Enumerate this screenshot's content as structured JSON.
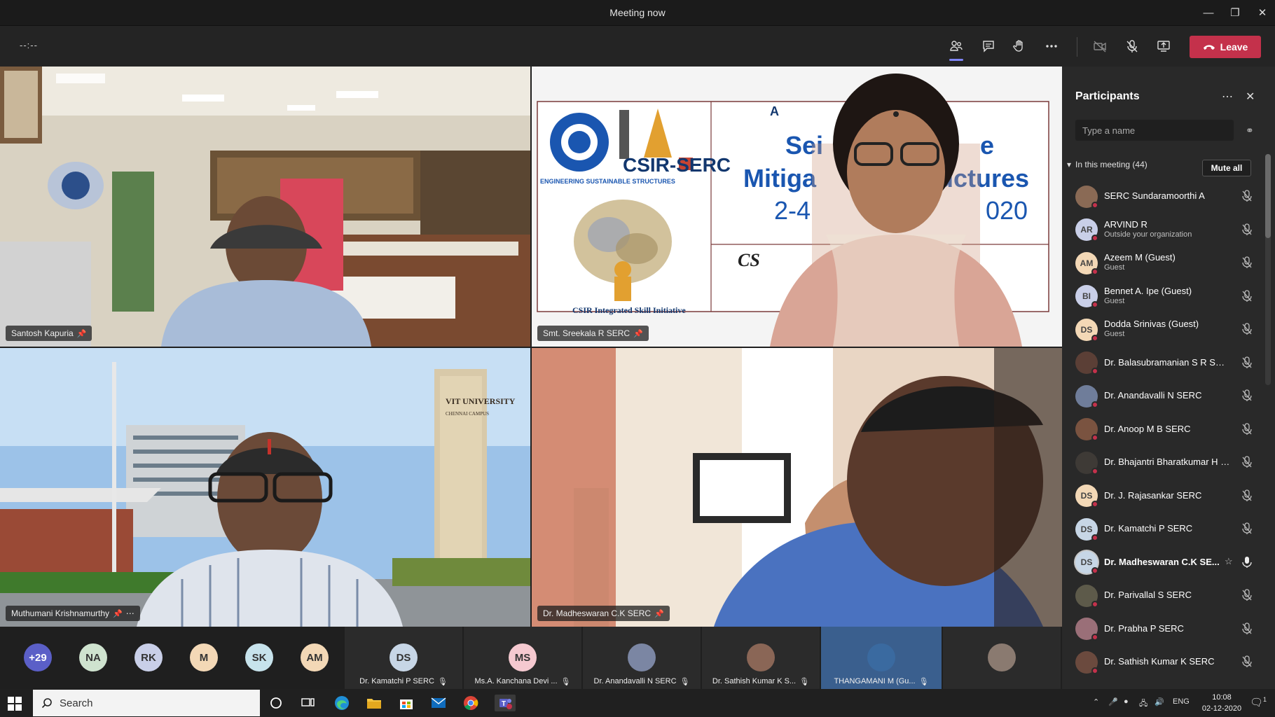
{
  "window": {
    "title": "Meeting now"
  },
  "toolbar": {
    "timer": "--:--",
    "leave_label": "Leave"
  },
  "videos": [
    {
      "name": "Santosh Kapuria"
    },
    {
      "name": "Smt. Sreekala R SERC",
      "slide": {
        "logo_text": "CSIR-SERC",
        "tagline": "ENGINEERING SUSTAINABLE STRUCTURES",
        "footer": "CSIR Integrated Skill Initiative",
        "line1": "Sei",
        "line1b": "e",
        "line2": "Mitiga",
        "line2b": "uctures",
        "line3": "2-4",
        "line3b": "020",
        "line4": "CS",
        "corner": "A"
      }
    },
    {
      "name": "Muthumani Krishnamurthy",
      "building_text": "VIT UNIVERSITY",
      "building_sub": "CHENNAI CAMPUS"
    },
    {
      "name": "Dr. Madheswaran C.K SERC"
    }
  ],
  "panel": {
    "title": "Participants",
    "search_placeholder": "Type a name",
    "section_label": "In this meeting (44)",
    "mute_all": "Mute all",
    "participants": [
      {
        "name": "SERC Sundaramoorthi A",
        "sub": "",
        "initials": "",
        "color": "#8a6a55"
      },
      {
        "name": "ARVIND R",
        "sub": "Outside your organization",
        "initials": "AR",
        "color": "#c9cfe8"
      },
      {
        "name": "Azeem M (Guest)",
        "sub": "Guest",
        "initials": "AM",
        "color": "#f3d8b6"
      },
      {
        "name": "Bennet A. Ipe (Guest)",
        "sub": "Guest",
        "initials": "BI",
        "color": "#c9cfe8"
      },
      {
        "name": "Dodda Srinivas (Guest)",
        "sub": "Guest",
        "initials": "DS",
        "color": "#f3d8b6"
      },
      {
        "name": "Dr. Balasubramanian S R SERC",
        "sub": "",
        "initials": "",
        "color": "#5b3f36"
      },
      {
        "name": "Dr. Anandavalli N SERC",
        "sub": "",
        "initials": "",
        "color": "#6f7d9a"
      },
      {
        "name": "Dr. Anoop M B SERC",
        "sub": "",
        "initials": "",
        "color": "#7a5340"
      },
      {
        "name": "Dr. Bhajantri Bharatkumar H S...",
        "sub": "",
        "initials": "",
        "color": "#3e3a36"
      },
      {
        "name": "Dr. J. Rajasankar SERC",
        "sub": "",
        "initials": "DS",
        "color": "#f3d8b6"
      },
      {
        "name": "Dr. Kamatchi P SERC",
        "sub": "",
        "initials": "DS",
        "color": "#c7d6e6"
      },
      {
        "name": "Dr. Madheswaran C.K SE...",
        "sub": "",
        "initials": "DS",
        "color": "#c7d6e6"
      },
      {
        "name": "Dr. Parivallal S SERC",
        "sub": "",
        "initials": "",
        "color": "#5d5a4a"
      },
      {
        "name": "Dr. Prabha P SERC",
        "sub": "",
        "initials": "",
        "color": "#9a6f78"
      },
      {
        "name": "Dr. Sathish Kumar K SERC",
        "sub": "",
        "initials": "",
        "color": "#6b4a3e"
      }
    ]
  },
  "gallery": {
    "overflow_count": "+29",
    "circles": [
      {
        "initials": "NA",
        "color": "#cfe3cf"
      },
      {
        "initials": "RK",
        "color": "#c9cfe8"
      },
      {
        "initials": "M",
        "color": "#f3d8b6"
      },
      {
        "initials": "SK",
        "color": "#c7e3ec"
      },
      {
        "initials": "AM",
        "color": "#f3d8b6"
      }
    ],
    "tiles": [
      {
        "name": "Dr. Kamatchi P SERC",
        "initials": "DS",
        "color": "#c7d6e6"
      },
      {
        "name": "Ms.A. Kanchana Devi ...",
        "initials": "MS",
        "color": "#f5c9d0"
      },
      {
        "name": "Dr. Anandavalli N SERC",
        "initials": "",
        "color": "#7b86a3"
      },
      {
        "name": "Dr. Sathish Kumar K S...",
        "initials": "",
        "color": "#8a6656"
      },
      {
        "name": "THANGAMANI M (Gu...",
        "initials": "",
        "color": "#3a6aa0"
      },
      {
        "name": "",
        "initials": "",
        "color": "#8a7a70"
      }
    ]
  },
  "taskbar": {
    "search_placeholder": "Search",
    "language": "ENG",
    "time": "10:08",
    "date": "02-12-2020",
    "notification_count": "1"
  }
}
